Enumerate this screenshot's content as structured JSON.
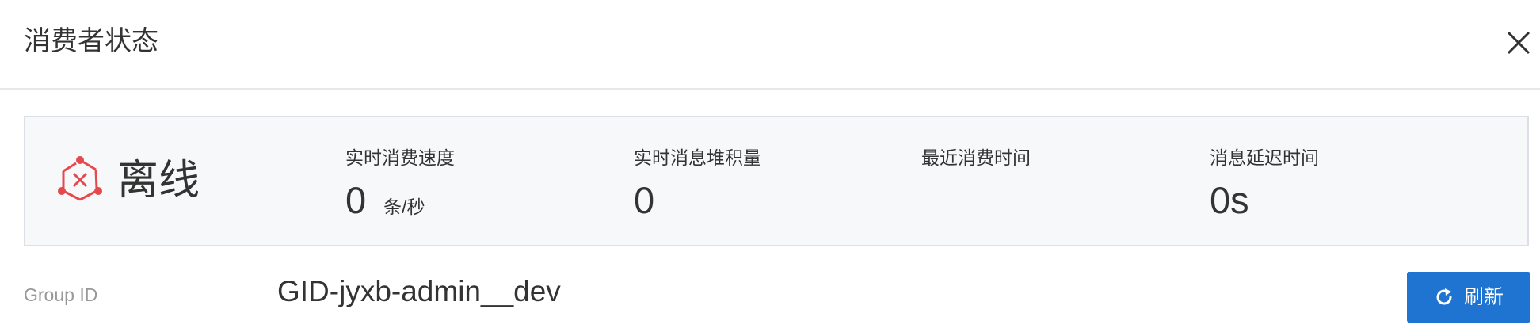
{
  "dialog": {
    "title": "消费者状态",
    "close_icon": "close-icon"
  },
  "status": {
    "state": "离线",
    "state_icon": "offline-icon",
    "state_color": "#e5484d",
    "metrics": [
      {
        "label": "实时消费速度",
        "value": "0",
        "unit": "条/秒"
      },
      {
        "label": "实时消息堆积量",
        "value": "0",
        "unit": ""
      },
      {
        "label": "最近消费时间",
        "value": "",
        "unit": ""
      },
      {
        "label": "消息延迟时间",
        "value": "0s",
        "unit": ""
      }
    ]
  },
  "group": {
    "label": "Group ID",
    "value": "GID-jyxb-admin__dev"
  },
  "actions": {
    "refresh_label": "刷新",
    "refresh_icon": "refresh-icon",
    "button_color": "#1f73d1"
  }
}
